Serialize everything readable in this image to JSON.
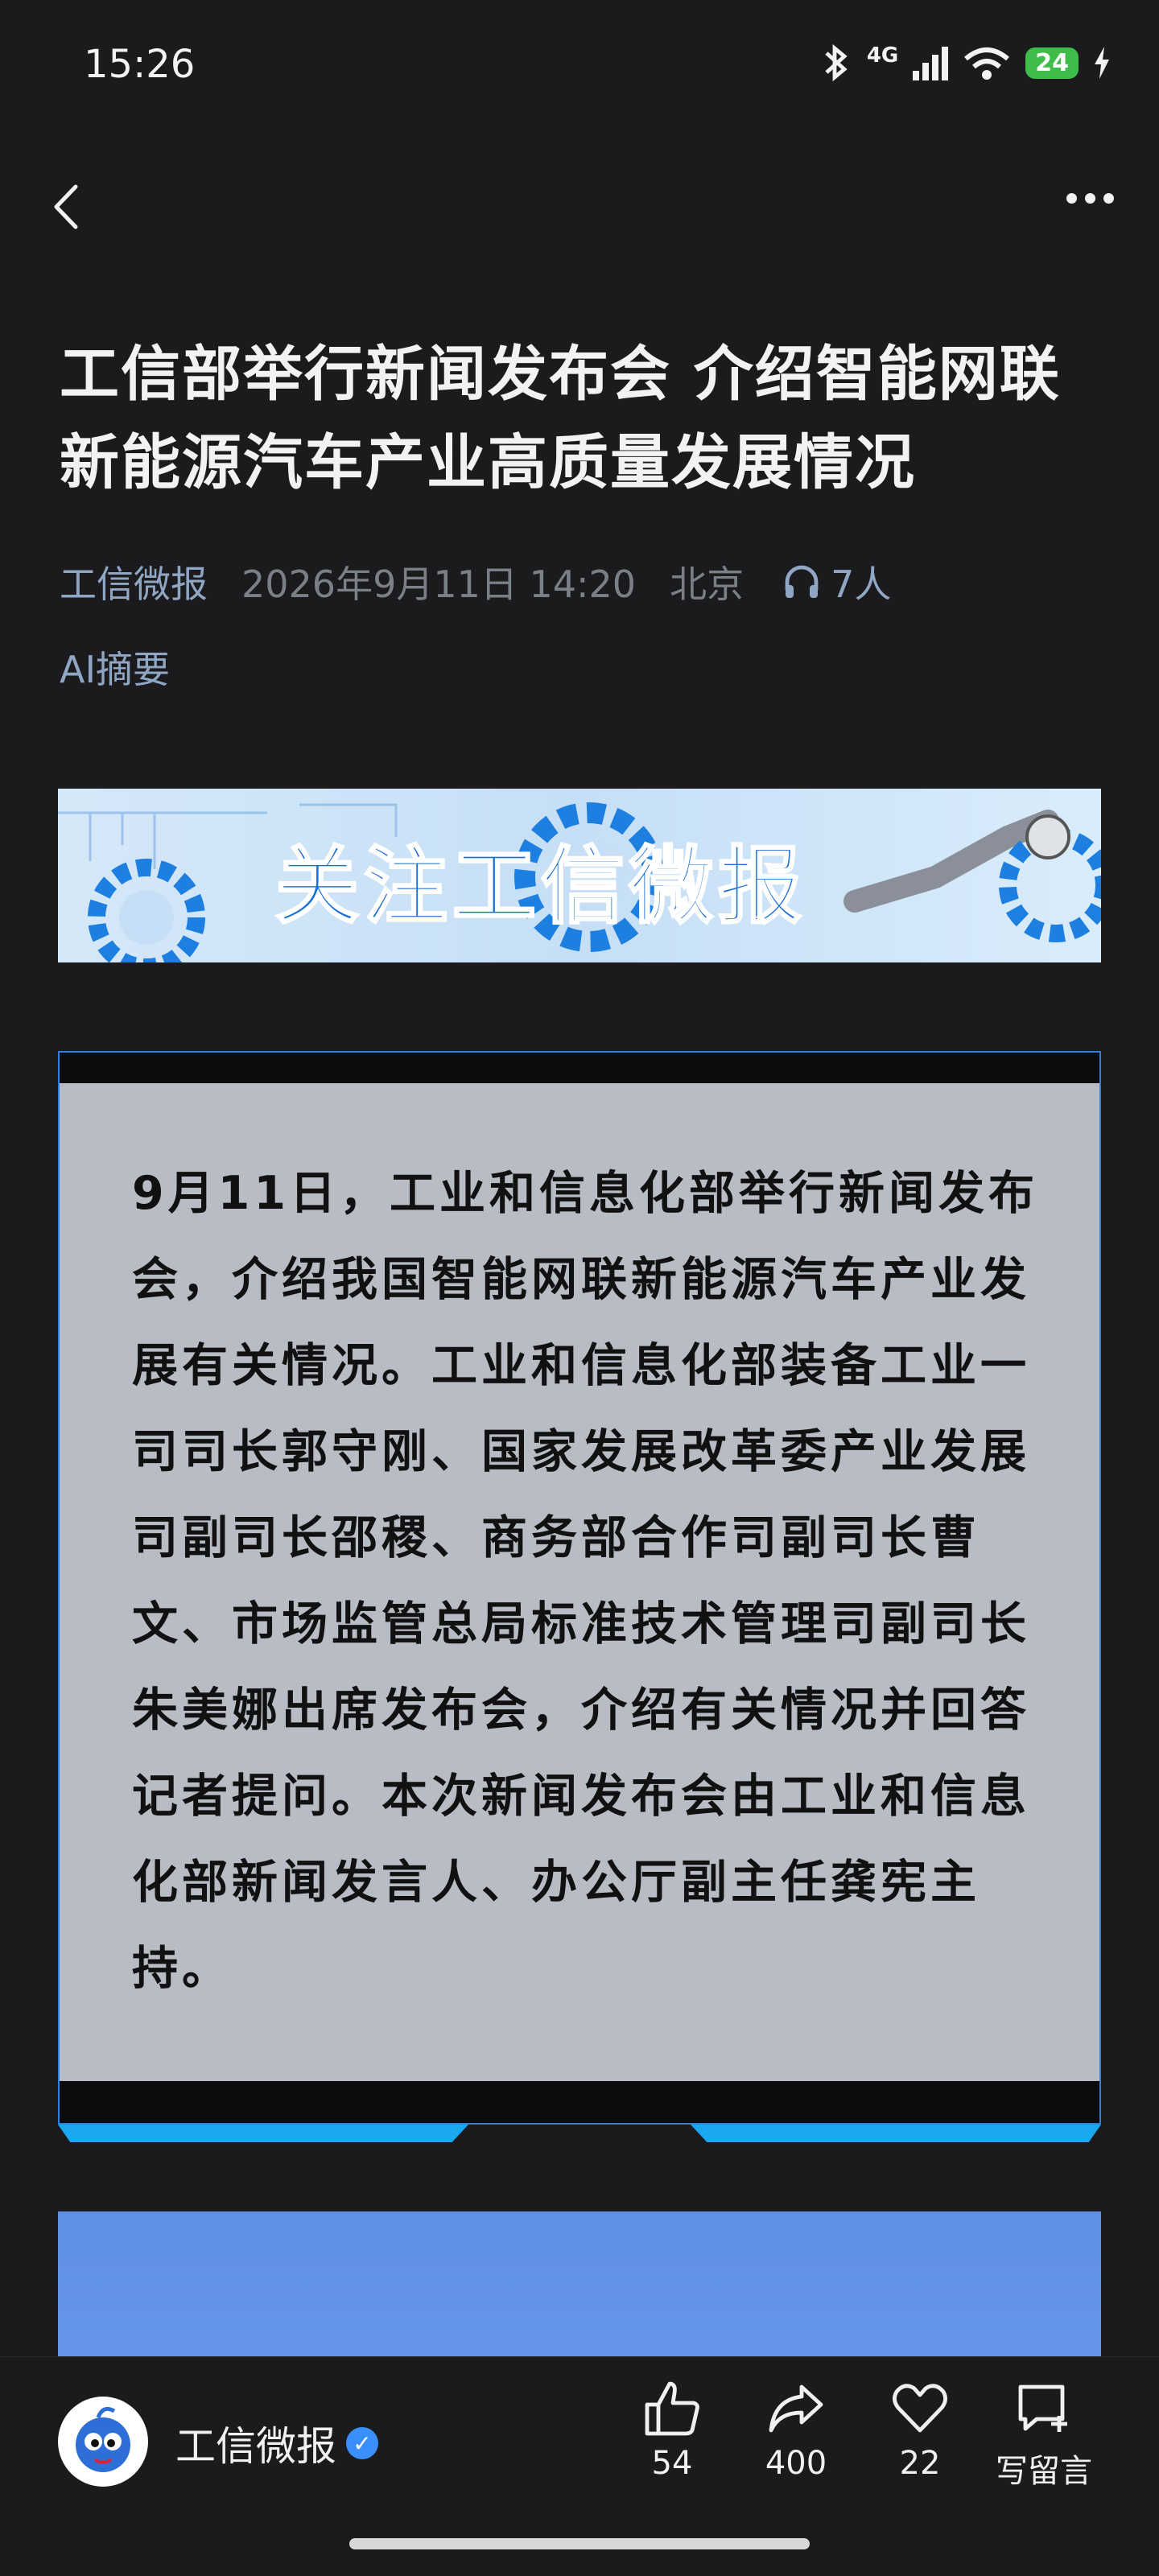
{
  "status_bar": {
    "time": "15:26",
    "network": "4G",
    "battery": "24"
  },
  "article": {
    "title": "工信部举行新闻发布会 介绍智能网联新能源汽车产业高质量发展情况",
    "author": "工信微报",
    "date": "2026年9月11日 14:20",
    "location": "北京",
    "listeners": "7人",
    "ai_summary_label": "AI摘要",
    "banner_text": "关注工信微报",
    "summary": "9月11日，工业和信息化部举行新闻发布会，介绍我国智能网联新能源汽车产业发展有关情况。工业和信息化部装备工业一司司长郭守刚、国家发展改革委产业发展司副司长邵稷、商务部合作司副司长曹文、市场监管总局标准技术管理司副司长朱美娜出席发布会，介绍有关情况并回答记者提问。本次新闻发布会由工业和信息化部新闻发言人、办公厅副主任龚宪主持。"
  },
  "bottom_bar": {
    "account_name": "工信微报",
    "likes": "54",
    "shares": "400",
    "favorites": "22",
    "comment_label": "写留言"
  },
  "colors": {
    "accent_blue": "#2f7fe0",
    "link": "#8fa6c4",
    "battery_green": "#3fbd4a",
    "verified": "#3a8fff"
  }
}
